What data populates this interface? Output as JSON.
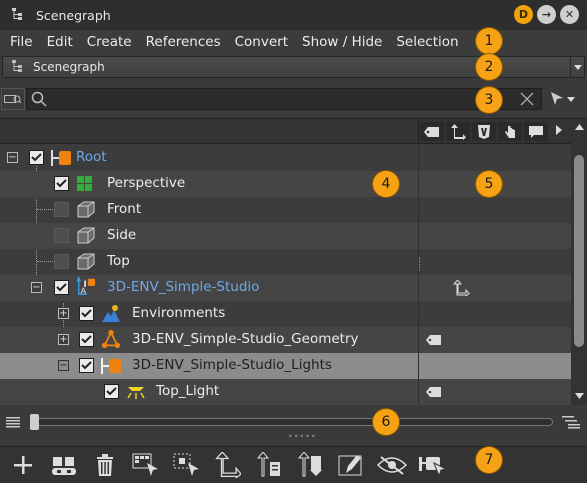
{
  "window": {
    "title": "Scenegraph",
    "buttons": [
      "D",
      "→",
      "✕"
    ]
  },
  "menu": [
    "File",
    "Edit",
    "Create",
    "References",
    "Convert",
    "Show / Hide",
    "Selection"
  ],
  "view_combo": {
    "value": "Scenegraph"
  },
  "search": {
    "value": "",
    "placeholder": ""
  },
  "tree": {
    "rows": [
      {
        "label": "Root",
        "checked": true,
        "color": "blue"
      },
      {
        "label": "Perspective",
        "checked": true
      },
      {
        "label": "Front",
        "checked": false
      },
      {
        "label": "Side",
        "checked": false
      },
      {
        "label": "Top",
        "checked": false
      },
      {
        "label": "3D-ENV_Simple-Studio",
        "checked": true,
        "color": "blue"
      },
      {
        "label": "Environments",
        "checked": true
      },
      {
        "label": "3D-ENV_Simple-Studio_Geometry",
        "checked": true
      },
      {
        "label": "3D-ENV_Simple-Studio_Lights",
        "checked": true,
        "selected": true
      },
      {
        "label": "Top_Light",
        "checked": true
      }
    ],
    "column_icons": [
      "tag-icon",
      "transform-icon",
      "v-icon",
      "hand-icon",
      "comment-icon"
    ]
  },
  "slider": {
    "level": 0
  },
  "toolbar": [
    "add-icon",
    "group-icon",
    "delete-icon",
    "select-tool-icon",
    "select-children-icon",
    "transform-icon",
    "move-up-icon",
    "move-down-icon",
    "edit-icon",
    "hide-icon",
    "pick-icon"
  ],
  "callouts": [
    "1",
    "2",
    "3",
    "4",
    "5",
    "6",
    "7"
  ],
  "colors": {
    "accent": "#f5a214",
    "blue_text": "#6ea8e8",
    "selection": "#8c8c8c"
  }
}
